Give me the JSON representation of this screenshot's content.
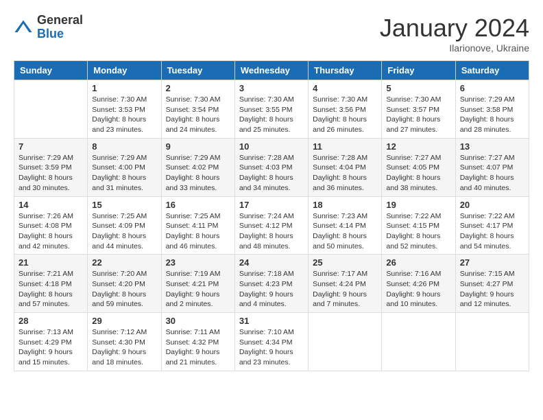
{
  "header": {
    "logo_general": "General",
    "logo_blue": "Blue",
    "title": "January 2024",
    "subtitle": "Ilarionove, Ukraine"
  },
  "days_of_week": [
    "Sunday",
    "Monday",
    "Tuesday",
    "Wednesday",
    "Thursday",
    "Friday",
    "Saturday"
  ],
  "weeks": [
    [
      {
        "day": "",
        "info": ""
      },
      {
        "day": "1",
        "info": "Sunrise: 7:30 AM\nSunset: 3:53 PM\nDaylight: 8 hours\nand 23 minutes."
      },
      {
        "day": "2",
        "info": "Sunrise: 7:30 AM\nSunset: 3:54 PM\nDaylight: 8 hours\nand 24 minutes."
      },
      {
        "day": "3",
        "info": "Sunrise: 7:30 AM\nSunset: 3:55 PM\nDaylight: 8 hours\nand 25 minutes."
      },
      {
        "day": "4",
        "info": "Sunrise: 7:30 AM\nSunset: 3:56 PM\nDaylight: 8 hours\nand 26 minutes."
      },
      {
        "day": "5",
        "info": "Sunrise: 7:30 AM\nSunset: 3:57 PM\nDaylight: 8 hours\nand 27 minutes."
      },
      {
        "day": "6",
        "info": "Sunrise: 7:29 AM\nSunset: 3:58 PM\nDaylight: 8 hours\nand 28 minutes."
      }
    ],
    [
      {
        "day": "7",
        "info": "Sunrise: 7:29 AM\nSunset: 3:59 PM\nDaylight: 8 hours\nand 30 minutes."
      },
      {
        "day": "8",
        "info": "Sunrise: 7:29 AM\nSunset: 4:00 PM\nDaylight: 8 hours\nand 31 minutes."
      },
      {
        "day": "9",
        "info": "Sunrise: 7:29 AM\nSunset: 4:02 PM\nDaylight: 8 hours\nand 33 minutes."
      },
      {
        "day": "10",
        "info": "Sunrise: 7:28 AM\nSunset: 4:03 PM\nDaylight: 8 hours\nand 34 minutes."
      },
      {
        "day": "11",
        "info": "Sunrise: 7:28 AM\nSunset: 4:04 PM\nDaylight: 8 hours\nand 36 minutes."
      },
      {
        "day": "12",
        "info": "Sunrise: 7:27 AM\nSunset: 4:05 PM\nDaylight: 8 hours\nand 38 minutes."
      },
      {
        "day": "13",
        "info": "Sunrise: 7:27 AM\nSunset: 4:07 PM\nDaylight: 8 hours\nand 40 minutes."
      }
    ],
    [
      {
        "day": "14",
        "info": "Sunrise: 7:26 AM\nSunset: 4:08 PM\nDaylight: 8 hours\nand 42 minutes."
      },
      {
        "day": "15",
        "info": "Sunrise: 7:25 AM\nSunset: 4:09 PM\nDaylight: 8 hours\nand 44 minutes."
      },
      {
        "day": "16",
        "info": "Sunrise: 7:25 AM\nSunset: 4:11 PM\nDaylight: 8 hours\nand 46 minutes."
      },
      {
        "day": "17",
        "info": "Sunrise: 7:24 AM\nSunset: 4:12 PM\nDaylight: 8 hours\nand 48 minutes."
      },
      {
        "day": "18",
        "info": "Sunrise: 7:23 AM\nSunset: 4:14 PM\nDaylight: 8 hours\nand 50 minutes."
      },
      {
        "day": "19",
        "info": "Sunrise: 7:22 AM\nSunset: 4:15 PM\nDaylight: 8 hours\nand 52 minutes."
      },
      {
        "day": "20",
        "info": "Sunrise: 7:22 AM\nSunset: 4:17 PM\nDaylight: 8 hours\nand 54 minutes."
      }
    ],
    [
      {
        "day": "21",
        "info": "Sunrise: 7:21 AM\nSunset: 4:18 PM\nDaylight: 8 hours\nand 57 minutes."
      },
      {
        "day": "22",
        "info": "Sunrise: 7:20 AM\nSunset: 4:20 PM\nDaylight: 8 hours\nand 59 minutes."
      },
      {
        "day": "23",
        "info": "Sunrise: 7:19 AM\nSunset: 4:21 PM\nDaylight: 9 hours\nand 2 minutes."
      },
      {
        "day": "24",
        "info": "Sunrise: 7:18 AM\nSunset: 4:23 PM\nDaylight: 9 hours\nand 4 minutes."
      },
      {
        "day": "25",
        "info": "Sunrise: 7:17 AM\nSunset: 4:24 PM\nDaylight: 9 hours\nand 7 minutes."
      },
      {
        "day": "26",
        "info": "Sunrise: 7:16 AM\nSunset: 4:26 PM\nDaylight: 9 hours\nand 10 minutes."
      },
      {
        "day": "27",
        "info": "Sunrise: 7:15 AM\nSunset: 4:27 PM\nDaylight: 9 hours\nand 12 minutes."
      }
    ],
    [
      {
        "day": "28",
        "info": "Sunrise: 7:13 AM\nSunset: 4:29 PM\nDaylight: 9 hours\nand 15 minutes."
      },
      {
        "day": "29",
        "info": "Sunrise: 7:12 AM\nSunset: 4:30 PM\nDaylight: 9 hours\nand 18 minutes."
      },
      {
        "day": "30",
        "info": "Sunrise: 7:11 AM\nSunset: 4:32 PM\nDaylight: 9 hours\nand 21 minutes."
      },
      {
        "day": "31",
        "info": "Sunrise: 7:10 AM\nSunset: 4:34 PM\nDaylight: 9 hours\nand 23 minutes."
      },
      {
        "day": "",
        "info": ""
      },
      {
        "day": "",
        "info": ""
      },
      {
        "day": "",
        "info": ""
      }
    ]
  ]
}
